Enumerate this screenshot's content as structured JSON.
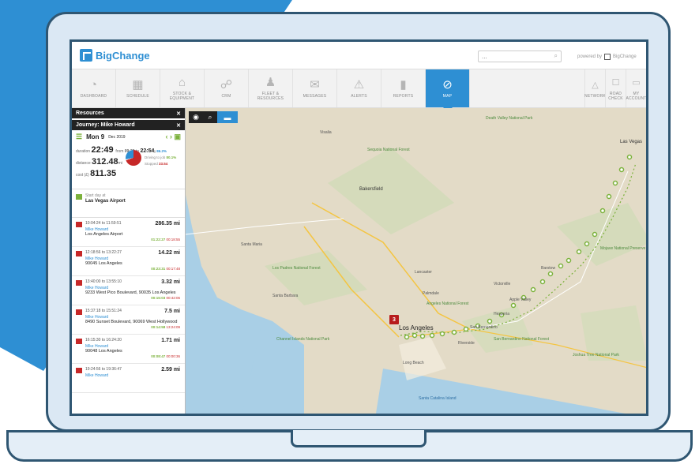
{
  "app": {
    "name": "BigChange",
    "search_value": "...",
    "powered_by": "powered by",
    "powered_brand": "BigChange"
  },
  "nav": [
    {
      "label": "DASHBOARD",
      "icon": "gauge-icon"
    },
    {
      "label": "SCHEDULE",
      "icon": "calendar-icon"
    },
    {
      "label": "STOCK & EQUIPMENT",
      "icon": "warehouse-icon"
    },
    {
      "label": "CRM",
      "icon": "handshake-icon"
    },
    {
      "label": "FLEET & RESOURCES",
      "icon": "people-icon"
    },
    {
      "label": "MESSAGES",
      "icon": "envelope-icon"
    },
    {
      "label": "ALERTS",
      "icon": "alert-icon"
    },
    {
      "label": "REPORTS",
      "icon": "chart-icon"
    },
    {
      "label": "MAP",
      "icon": "compass-icon",
      "active": true
    }
  ],
  "nav_right": [
    {
      "label": "NETWORK",
      "icon": "network-icon"
    },
    {
      "label": "ROAD CHECK",
      "icon": "clipboard-icon"
    },
    {
      "label": "MY ACCOUNT",
      "icon": "id-card-icon"
    }
  ],
  "panel": {
    "resources_title": "Resources",
    "journey_title": "Journey: Mike Howard",
    "date": "Mon 9",
    "date_small": "Dec 2019",
    "stats": {
      "duration_label": "duration",
      "duration": "22:49",
      "from": "from",
      "from_time": "09:30",
      "to": "to",
      "to_time": "22:54",
      "distance_label": "distance",
      "distance": "312.48",
      "distance_unit": "mi",
      "cost_label": "cost (£)",
      "cost": "811.35",
      "driving_label": "Driving",
      "driving": "86.2%",
      "driving_job_label": "Driving to job",
      "driving_job": "80.1%",
      "stopped_label": "Stopped",
      "stopped": "33.54"
    },
    "start": {
      "label": "Start day at",
      "place": "Las Vegas Airport"
    },
    "jobs": [
      {
        "times": "10:04:24 to 11:59:51",
        "distance": "286.35 mi",
        "name": "Mike Howard",
        "address": "Los Angeles Airport",
        "t1": "01:22:27",
        "t2": "00:18:55"
      },
      {
        "times": "12:18:56 to 13:22:27",
        "distance": "14.22 mi",
        "name": "Mike Howard",
        "address": "90045 Los Angeles",
        "t1": "00:23:31",
        "t2": "00:17:48"
      },
      {
        "times": "13:40:00 to 13:55:10",
        "distance": "3.32 mi",
        "name": "Mike Howard",
        "address": "9233 West Pico Boulevard, 90035 Los Angeles",
        "t1": "00:15:03",
        "t2": "00:42:06"
      },
      {
        "times": "15:37:18 to 15:51:24",
        "distance": "7.5 mi",
        "name": "Mike Howard",
        "address": "8490 Sunset Boulevard, 90069 West Hollywood",
        "t1": "00:14:58",
        "t2": "13:24:09"
      },
      {
        "times": "16:15:30 to 16:24:20",
        "distance": "1.71 mi",
        "name": "Mike Howard",
        "address": "90048 Los Angeles",
        "t1": "00:08:47",
        "t2": "00:00:36"
      },
      {
        "times": "19:24:56 to 19:36:47",
        "distance": "2.59 mi",
        "name": "Mike Howard",
        "address": "",
        "t1": "",
        "t2": ""
      }
    ]
  },
  "map": {
    "cluster_count": "3",
    "labels": [
      {
        "text": "Sequoia National Forest",
        "cls": "green"
      },
      {
        "text": "Bakersfield",
        "cls": "city"
      },
      {
        "text": "Santa Maria",
        "cls": ""
      },
      {
        "text": "Los Padres National Forest",
        "cls": "green"
      },
      {
        "text": "Santa Barbara",
        "cls": ""
      },
      {
        "text": "Lancaster",
        "cls": ""
      },
      {
        "text": "Victorville",
        "cls": ""
      },
      {
        "text": "Apple Valley",
        "cls": ""
      },
      {
        "text": "Angeles National Forest",
        "cls": "green"
      },
      {
        "text": "Hesperia",
        "cls": ""
      },
      {
        "text": "Los Angeles",
        "cls": "bigcity"
      },
      {
        "text": "San Bernardino",
        "cls": ""
      },
      {
        "text": "San Bernardino National Forest",
        "cls": "green"
      },
      {
        "text": "Riverside",
        "cls": ""
      },
      {
        "text": "Long Beach",
        "cls": ""
      },
      {
        "text": "Channel Islands National Park",
        "cls": "green"
      },
      {
        "text": "Joshua Tree National Park",
        "cls": "green"
      },
      {
        "text": "Mojave National Preserve",
        "cls": "green"
      },
      {
        "text": "Las Vegas",
        "cls": "city"
      },
      {
        "text": "Visalia",
        "cls": ""
      },
      {
        "text": "Death Valley National Park",
        "cls": "green"
      },
      {
        "text": "Santa Catalina Island",
        "cls": "blue"
      },
      {
        "text": "Barstow",
        "cls": ""
      },
      {
        "text": "Palmdale",
        "cls": ""
      }
    ]
  },
  "colors": {
    "brand": "#2e8fd3",
    "accent_green": "#7bb13b",
    "alert_red": "#c62828",
    "frame": "#2f5672"
  }
}
